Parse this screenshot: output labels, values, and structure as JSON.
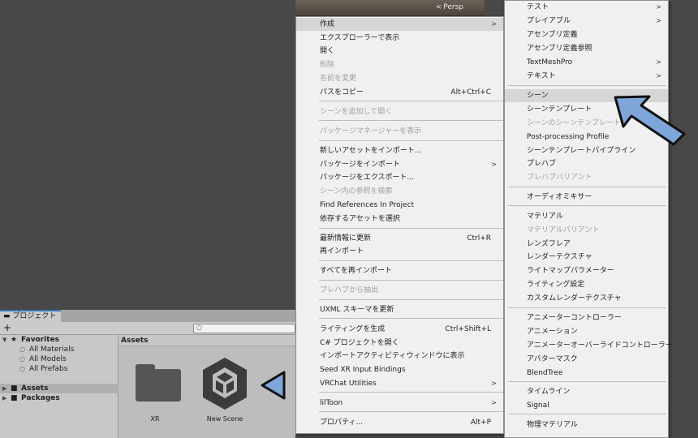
{
  "scene": {
    "persp_label": "Persp"
  },
  "project": {
    "tab_label": "プロジェクト",
    "add_label": "+",
    "tree": [
      {
        "label": "Favorites",
        "icon": "star-icon",
        "bold": true,
        "level": 0,
        "expanded": true
      },
      {
        "label": "All Materials",
        "icon": "search-icon",
        "level": 1
      },
      {
        "label": "All Models",
        "icon": "search-icon",
        "level": 1
      },
      {
        "label": "All Prefabs",
        "icon": "search-icon",
        "level": 1
      },
      {
        "label": "Assets",
        "icon": "folder-icon",
        "bold": true,
        "level": 0,
        "selected": true
      },
      {
        "label": "Packages",
        "icon": "folder-icon",
        "bold": true,
        "level": 0
      }
    ],
    "assets_header": "Assets",
    "assets": [
      {
        "label": "XR",
        "icon": "folder-icon"
      },
      {
        "label": "New Scene",
        "icon": "unity-scene-icon"
      }
    ]
  },
  "menu_left": {
    "items": [
      {
        "label": "作成",
        "submenu": true,
        "highlighted": true
      },
      {
        "label": "エクスプローラーで表示"
      },
      {
        "label": "開く"
      },
      {
        "label": "削除",
        "disabled": true
      },
      {
        "label": "名前を変更",
        "disabled": true
      },
      {
        "label": "パスをコピー",
        "shortcut": "Alt+Ctrl+C"
      },
      {
        "label": "シーンを追加して開く",
        "disabled": true
      },
      {
        "label": "パッケージマネージャーを表示",
        "disabled": true
      },
      {
        "label": "新しいアセットをインポート..."
      },
      {
        "label": "パッケージをインポート",
        "submenu": true
      },
      {
        "label": "パッケージをエクスポート..."
      },
      {
        "label": "シーン内の参照を検索",
        "disabled": true
      },
      {
        "label": "Find References In Project"
      },
      {
        "label": "依存するアセットを選択"
      },
      {
        "label": "最新情報に更新",
        "shortcut": "Ctrl+R"
      },
      {
        "label": "再インポート"
      },
      {
        "label": "すべてを再インポート"
      },
      {
        "label": "プレハブから抽出",
        "disabled": true
      },
      {
        "label": "UXML スキーマを更新"
      },
      {
        "label": "ライティングを生成",
        "shortcut": "Ctrl+Shift+L"
      },
      {
        "label": "C# プロジェクトを開く"
      },
      {
        "label": "インポートアクティビティウィンドウに表示"
      },
      {
        "label": "Seed XR Input Bindings"
      },
      {
        "label": "VRChat Utilities",
        "submenu": true
      },
      {
        "label": "lilToon",
        "submenu": true
      },
      {
        "label": "プロパティ...",
        "shortcut": "Alt+P"
      }
    ]
  },
  "menu_right": {
    "items": [
      {
        "label": "テスト",
        "submenu": true
      },
      {
        "label": "プレイアブル",
        "submenu": true
      },
      {
        "label": "アセンブリ定義"
      },
      {
        "label": "アセンブリ定義参照"
      },
      {
        "label": "TextMeshPro",
        "submenu": true
      },
      {
        "label": "テキスト",
        "submenu": true
      },
      {
        "label": "シーン",
        "highlighted": true
      },
      {
        "label": "シーンテンプレート"
      },
      {
        "label": "シーンのシーンテンプレート",
        "disabled": true
      },
      {
        "label": "Post-processing Profile"
      },
      {
        "label": "シーンテンプレートパイプライン"
      },
      {
        "label": "プレハブ"
      },
      {
        "label": "プレハブバリアント",
        "disabled": true
      },
      {
        "label": "オーディオミキサー"
      },
      {
        "label": "マテリアル"
      },
      {
        "label": "マテリアルバリアント",
        "disabled": true
      },
      {
        "label": "レンズフレア"
      },
      {
        "label": "レンダーテクスチャ"
      },
      {
        "label": "ライトマップパラメーター"
      },
      {
        "label": "ライティング設定"
      },
      {
        "label": "カスタムレンダーテクスチャ"
      },
      {
        "label": "アニメーターコントローラー"
      },
      {
        "label": "アニメーション"
      },
      {
        "label": "アニメーターオーバーライドコントローラー"
      },
      {
        "label": "アバターマスク"
      },
      {
        "label": "BlendTree"
      },
      {
        "label": "タイムライン"
      },
      {
        "label": "Signal"
      },
      {
        "label": "物理マテリアル"
      }
    ]
  },
  "colors": {
    "accent_arrow": "#7ea6d9",
    "highlight": "#d6d6d6",
    "disabled_text": "#a0a0a0"
  }
}
